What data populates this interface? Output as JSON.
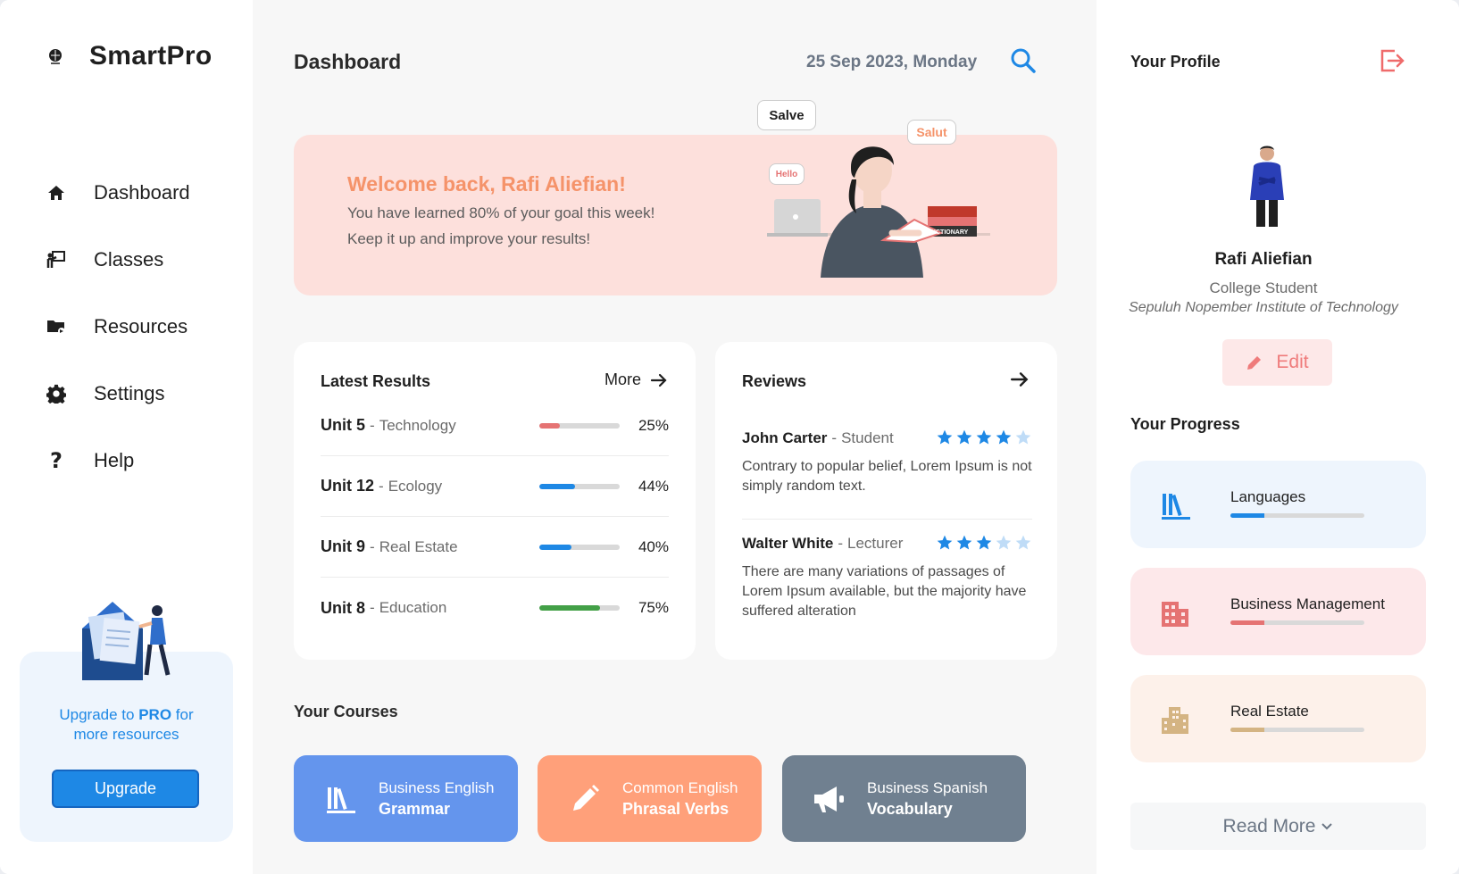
{
  "brand": {
    "name": "SmartPro",
    "logo_icon": "logo-icon"
  },
  "sidebar": {
    "items": [
      {
        "label": "Dashboard",
        "icon": "home-icon"
      },
      {
        "label": "Classes",
        "icon": "presentation-icon"
      },
      {
        "label": "Resources",
        "icon": "folder-icon"
      },
      {
        "label": "Settings",
        "icon": "gear-icon"
      },
      {
        "label": "Help",
        "icon": "help-icon"
      }
    ],
    "upgrade": {
      "text_prefix": "Upgrade to ",
      "text_pro": "PRO",
      "text_suffix": " for",
      "text_line2": "more resources",
      "button_label": "Upgrade"
    }
  },
  "header": {
    "title": "Dashboard",
    "date": "25 Sep 2023, Monday"
  },
  "welcome": {
    "title": "Welcome back, Rafi Aliefian!",
    "line1": "You have learned 80% of your goal this week!",
    "line2": "Keep it up and improve your results!",
    "bubbles": [
      "Salve",
      "Salut",
      "Hello"
    ],
    "book_labels": [
      "DICTIONARY"
    ]
  },
  "results": {
    "title": "Latest Results",
    "more_label": "More",
    "separator": "-",
    "items": [
      {
        "unit": "Unit 5",
        "topic": "Technology",
        "percent_label": "25%",
        "percent": 25,
        "color": "#e57373"
      },
      {
        "unit": "Unit 12",
        "topic": "Ecology",
        "percent_label": "44%",
        "percent": 44,
        "color": "#1e88e5"
      },
      {
        "unit": "Unit 9",
        "topic": "Real Estate",
        "percent_label": "40%",
        "percent": 40,
        "color": "#1e88e5"
      },
      {
        "unit": "Unit 8",
        "topic": "Education",
        "percent_label": "75%",
        "percent": 75,
        "color": "#43a047"
      }
    ]
  },
  "reviews": {
    "title": "Reviews",
    "separator": "-",
    "items": [
      {
        "name": "John Carter",
        "role": "Student",
        "rating": 4,
        "text": "Contrary to popular belief, Lorem Ipsum is not simply random text."
      },
      {
        "name": "Walter White",
        "role": "Lecturer",
        "rating": 3,
        "text": "There are many variations of passages of Lorem Ipsum available, but the majority have suffered alteration"
      }
    ]
  },
  "courses": {
    "title": "Your Courses",
    "items": [
      {
        "sub": "Business English",
        "name": "Grammar",
        "color": "#6495ed",
        "icon": "books-icon"
      },
      {
        "sub": "Common English",
        "name": "Phrasal Verbs",
        "color": "#ffa07a",
        "icon": "pencil-icon"
      },
      {
        "sub": "Business Spanish",
        "name": "Vocabulary",
        "color": "#708090",
        "icon": "megaphone-icon"
      }
    ]
  },
  "profile": {
    "title": "Your Profile",
    "name": "Rafi Aliefian",
    "role": "College Student",
    "institution": "Sepuluh Nopember Institute of Technology",
    "edit_label": "Edit",
    "progress_title": "Your Progress",
    "progress": [
      {
        "name": "Languages",
        "percent": 25,
        "bg": "#eef5fd",
        "color": "#1e88e5",
        "icon": "books-icon"
      },
      {
        "name": "Business Management",
        "percent": 25,
        "bg": "#fde8ea",
        "color": "#e57373",
        "icon": "building-icon"
      },
      {
        "name": "Real Estate",
        "percent": 25,
        "bg": "#fdf1ea",
        "color": "#d4b483",
        "icon": "city-icon"
      }
    ],
    "read_more_label": "Read More"
  },
  "colors": {
    "accent": "#1e88e5",
    "salmon": "#f5936a",
    "pink_bg": "#fde0dc"
  }
}
